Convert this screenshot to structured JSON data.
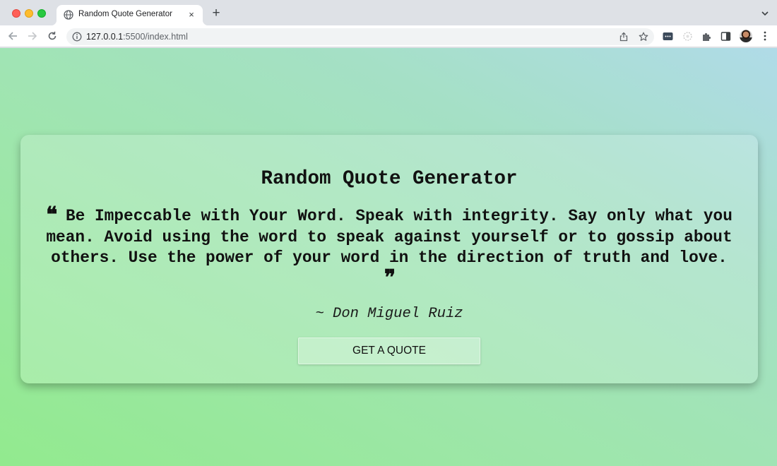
{
  "browser": {
    "tab_title": "Random Quote Generator",
    "tab_close": "×",
    "new_tab": "+",
    "url_host": "127.0.0.1",
    "url_path": ":5500/index.html"
  },
  "page": {
    "heading": "Random Quote Generator",
    "quote_open": "❝",
    "quote_text": "Be Impeccable with Your Word. Speak with integrity. Say only what you mean. Avoid using the word to speak against yourself or to gossip about others. Use the power of your word in the direction of truth and love.",
    "quote_close": "❞",
    "author": "~ Don Miguel Ruiz",
    "button_label": "GET A QUOTE"
  },
  "colors": {
    "gradient_top_right": "#b0dbe8",
    "gradient_bottom_left": "#92ea8e",
    "text": "#111111"
  },
  "icons": [
    "globe-icon",
    "close-icon",
    "plus-icon",
    "chevron-down-icon",
    "back-arrow-icon",
    "forward-arrow-icon",
    "reload-icon",
    "info-icon",
    "share-icon",
    "star-icon",
    "extension-icon",
    "puzzle-icon",
    "side-panel-icon",
    "avatar",
    "kebab-menu-icon",
    "quote-open-icon",
    "quote-close-icon"
  ]
}
